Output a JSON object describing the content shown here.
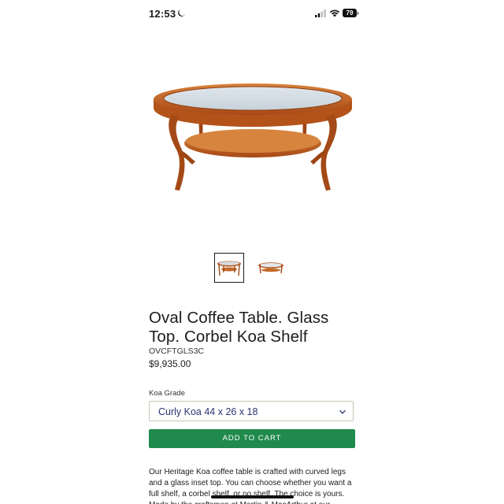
{
  "status_bar": {
    "time": "12:53",
    "battery": "79"
  },
  "product": {
    "title": "Oval Coffee Table. Glass Top. Corbel Koa Shelf",
    "sku": "OVCFTGLS3C",
    "price": "$9,935.00",
    "option_label": "Koa Grade",
    "selected_option": "Curly Koa 44 x 26 x 18",
    "add_to_cart": "ADD TO CART",
    "description": "Our Heritage Koa coffee table is crafted with curved legs and a glass inset top. You can choose whether you want a full shelf, a corbel shelf, or no shelf. The choice is yours. Made by the craftsmen at Martin & MacArthur at our"
  },
  "colors": {
    "add_to_cart_bg": "#1f8a4c",
    "select_text": "#2a3470",
    "wood": "#b5561f"
  },
  "icons": [
    "moon-icon",
    "signal-icon",
    "wifi-icon",
    "battery-icon",
    "chevron-down-icon"
  ]
}
